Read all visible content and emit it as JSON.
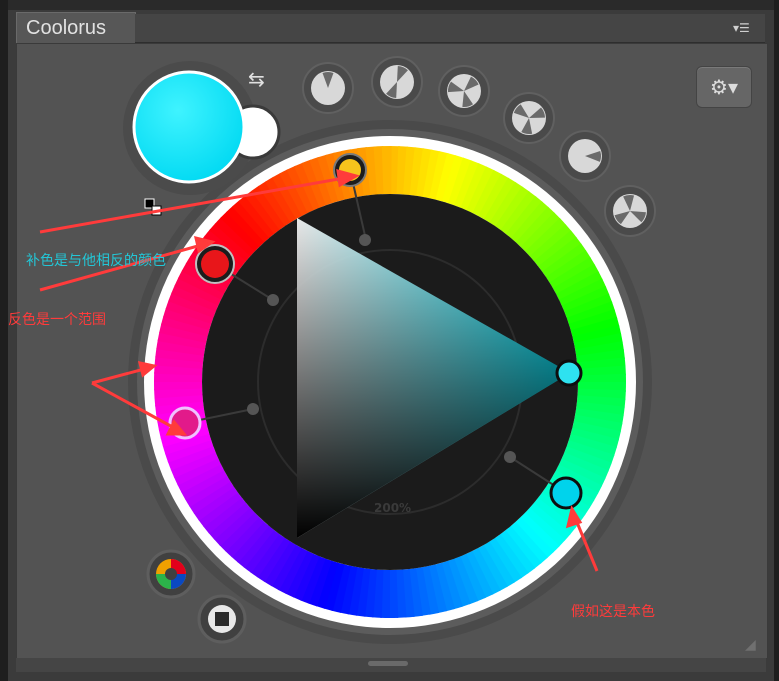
{
  "panel": {
    "title": "Coolorus",
    "menu_icon": "panel-menu-icon",
    "settings_icon": "gear-icon"
  },
  "colors": {
    "foreground": "#00e5fa",
    "background": "#ffffff",
    "ring_frame": "#ffffff",
    "annotation_red": "#ff3b3b",
    "annotation_teal": "#23c6d6"
  },
  "wheel": {
    "zoom_label": "200%",
    "handles": [
      {
        "name": "yellow-handle",
        "color": "#f7c41c"
      },
      {
        "name": "red-handle",
        "color": "#e8161a"
      },
      {
        "name": "magenta-handle",
        "color": "#e21a8a"
      },
      {
        "name": "cyan-handle-base",
        "color": "#00d3ec"
      },
      {
        "name": "triangle-cyan-handle",
        "color": "#2ee2f0"
      }
    ]
  },
  "scheme_buttons": [
    "scheme-monochrome-icon",
    "scheme-complementary-icon",
    "scheme-triad-icon",
    "scheme-split-icon",
    "scheme-analogous-icon",
    "scheme-tetrad-icon"
  ],
  "annotations": {
    "complement": "补色是与他相反的颜色",
    "inverse": "反色是一个范围",
    "base": "假如这是本色"
  }
}
